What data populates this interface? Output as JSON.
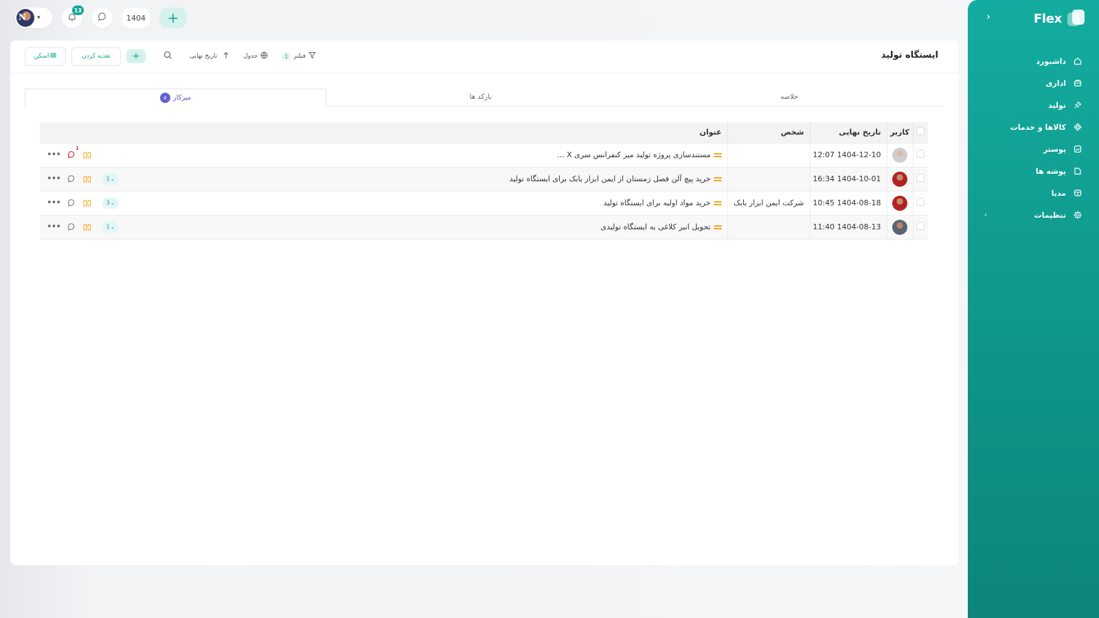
{
  "app": {
    "brand": "Flex"
  },
  "topbar": {
    "notification_count": "13",
    "year": "1404"
  },
  "sidebar": {
    "items": [
      {
        "label": "داشبورد",
        "icon": "home-icon"
      },
      {
        "label": "اداری",
        "icon": "briefcase-icon"
      },
      {
        "label": "تولید",
        "icon": "pin-icon"
      },
      {
        "label": "کالاها و خدمات",
        "icon": "diamond-icon"
      },
      {
        "label": "پوستر",
        "icon": "image-icon"
      },
      {
        "label": "پوشه ها",
        "icon": "folder-icon"
      },
      {
        "label": "مدیا",
        "icon": "media-icon"
      },
      {
        "label": "تنظیمات",
        "icon": "gear-icon"
      }
    ]
  },
  "page": {
    "title": "ایستگاه تولید",
    "toolbar": {
      "scan_label": "اسکن",
      "feed_label": "تغذیه کردن",
      "sort_label": "تاریخ نهایی",
      "view_label": "جدول",
      "filter_label": "فیلتر",
      "filter_count": "1"
    },
    "tabs": [
      {
        "label": "میزکار",
        "count": "4"
      },
      {
        "label": "بارکد ها"
      },
      {
        "label": "خلاصه"
      }
    ]
  },
  "table": {
    "headers": {
      "user": "کاربر",
      "due_date": "تاریخ نهایی",
      "person": "شخص",
      "title": "عنوان"
    },
    "rows": [
      {
        "date": "1404-12-10 12:07",
        "person": "",
        "title": "مستندسازی پروژه تولید میز کنفرانس سری X ...",
        "subtasks": "",
        "chat_badge": "1"
      },
      {
        "date": "1404-10-01 16:34",
        "person": "",
        "title": "خرید پیچ آلن فصل زمستان از ایمن ابزار بابک برای ایستگاه تولید",
        "subtasks": "1",
        "chat_badge": ""
      },
      {
        "date": "1404-08-18 10:45",
        "person": "شرکت ایمن ابزار بابک",
        "title": "خرید مواد اولیه برای ایستگاه تولید",
        "subtasks": "3",
        "chat_badge": ""
      },
      {
        "date": "1404-08-13 11:40",
        "person": "",
        "title": "تحویل انبر کلاغی به ایستگاه تولیدی",
        "subtasks": "1",
        "chat_badge": ""
      }
    ]
  },
  "colors": {
    "accent": "#12a89c",
    "tab_active": "#5b57c9",
    "priority": "#f3a61e",
    "alert": "#d32f2f"
  }
}
